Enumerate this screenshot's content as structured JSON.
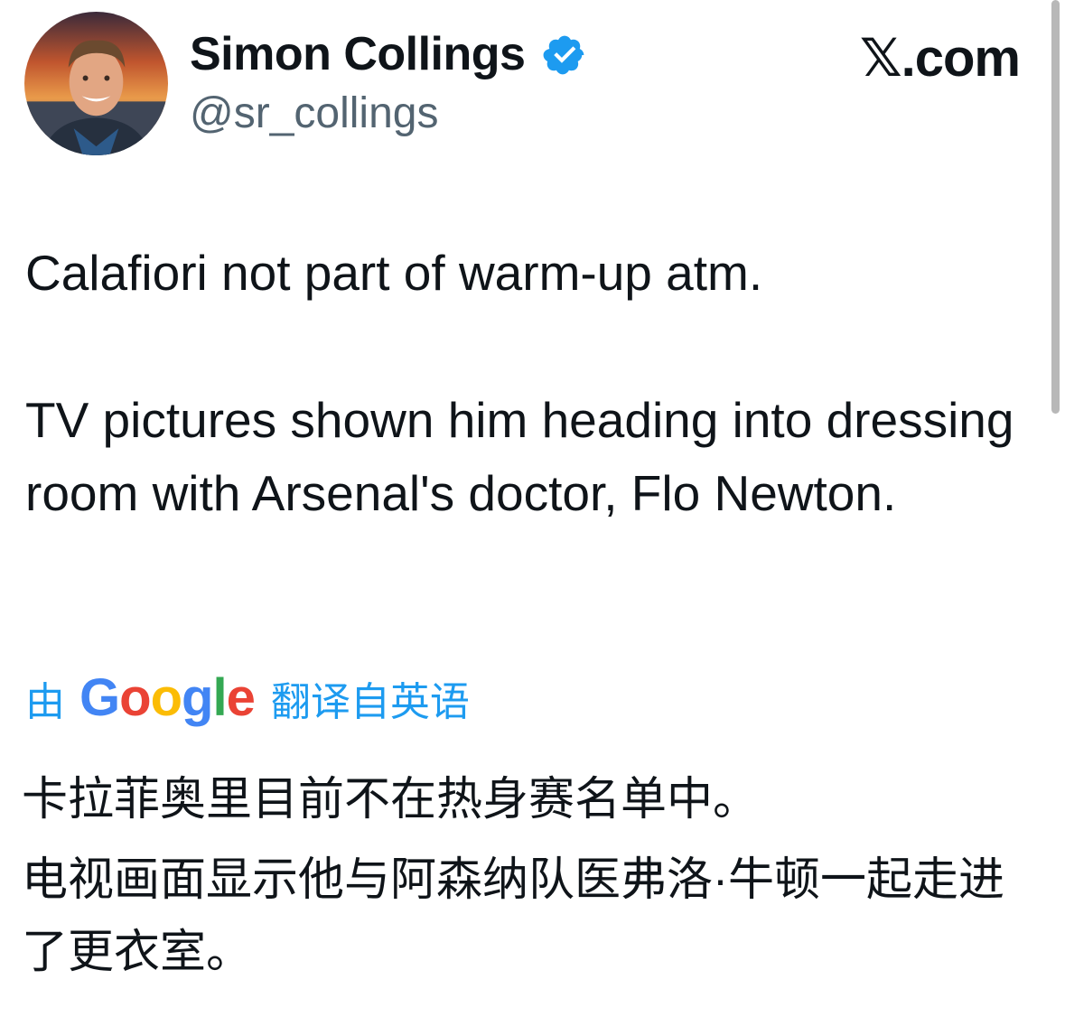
{
  "author": {
    "display_name": "Simon Collings",
    "handle": "@sr_collings",
    "verified": true
  },
  "brand": "𝕏.com",
  "tweet": {
    "paragraphs": [
      "Calafiori not part of warm-up atm.",
      "TV pictures shown him heading into dressing room with Arsenal's doctor, Flo Newton."
    ]
  },
  "translation": {
    "prefix": "由",
    "provider_letters": [
      "G",
      "o",
      "o",
      "g",
      "l",
      "e"
    ],
    "suffix": "翻译自英语",
    "paragraphs": [
      "卡拉菲奥里目前不在热身赛名单中。",
      "电视画面显示他与阿森纳队医弗洛·牛顿一起走进了更衣室。"
    ]
  },
  "icons": {
    "avatar": "profile-photo",
    "verified": "verified-badge-icon"
  },
  "colors": {
    "text": "#0f1419",
    "secondary_text": "#536471",
    "link": "#1d9bf0",
    "verified": "#1d9bf0"
  }
}
